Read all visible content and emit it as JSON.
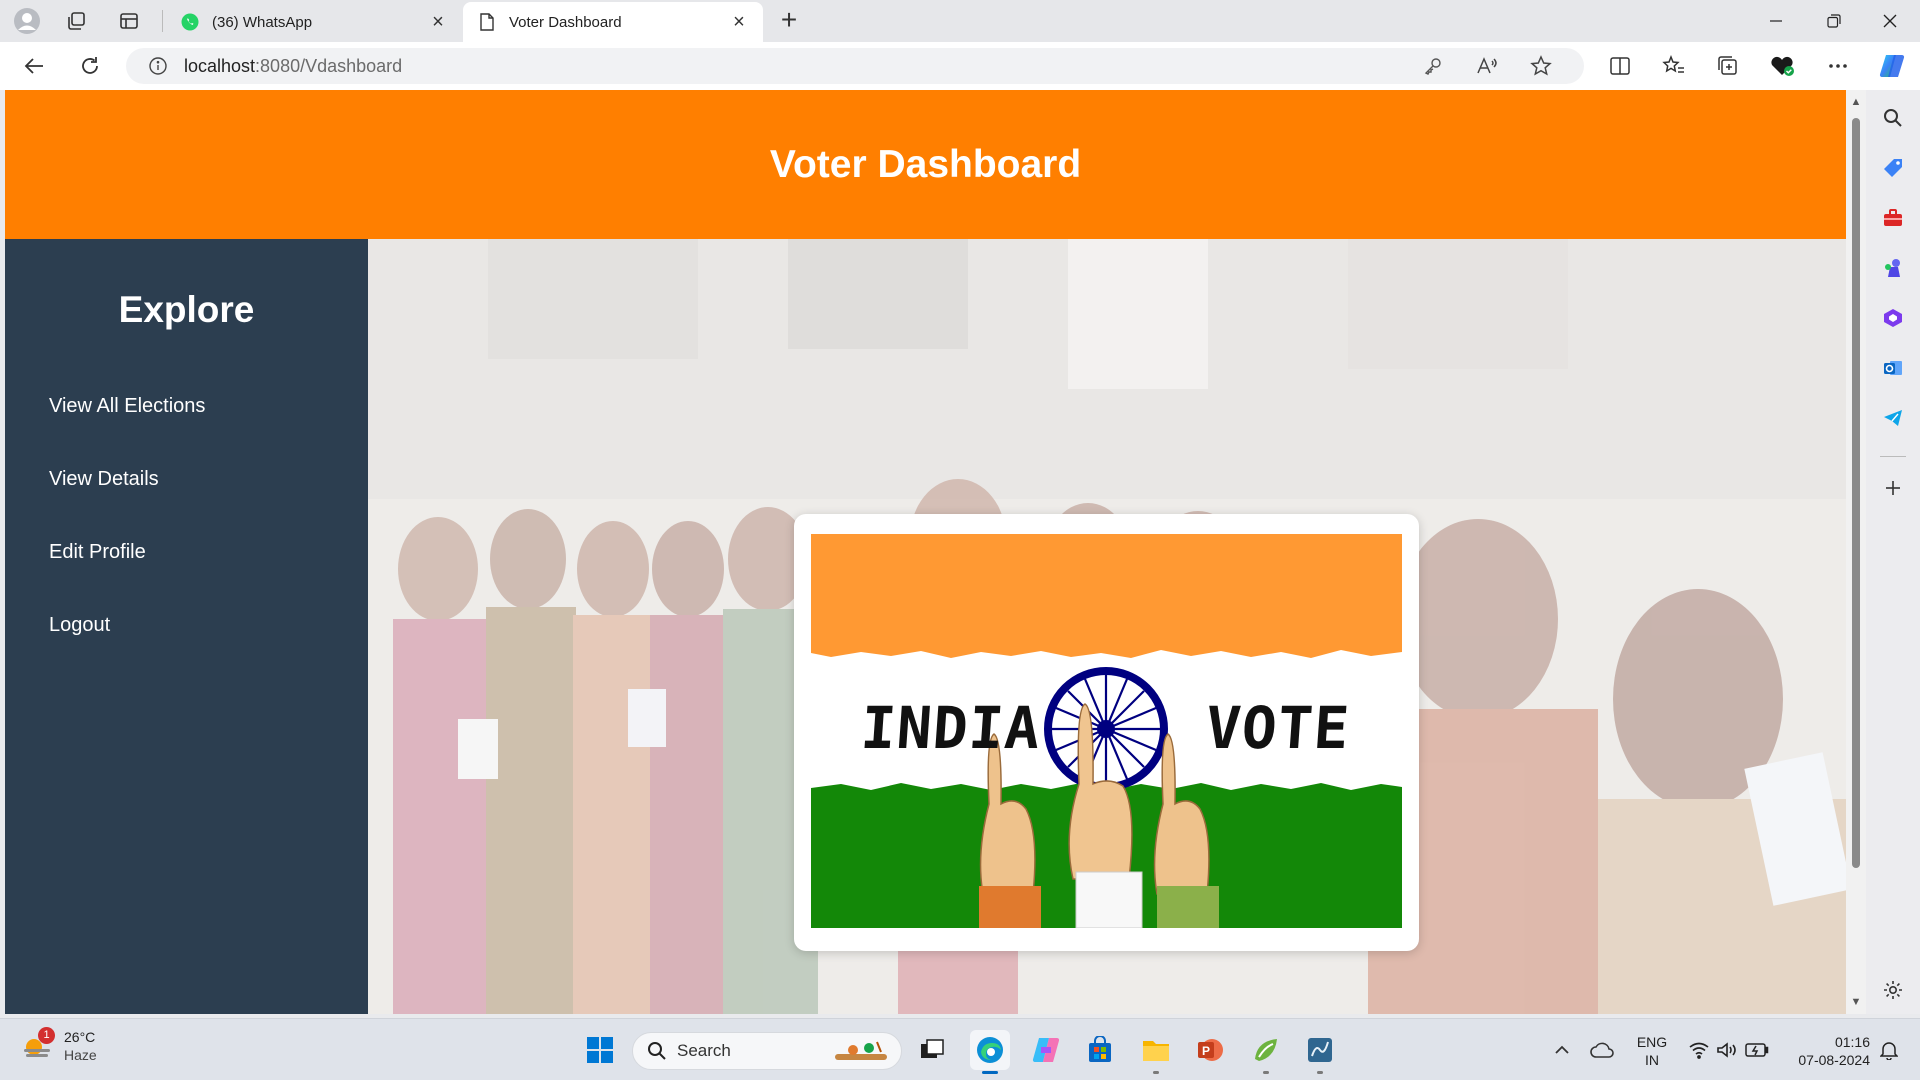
{
  "browser": {
    "tabs": [
      {
        "title": "(36) WhatsApp",
        "active": false
      },
      {
        "title": "Voter Dashboard",
        "active": true
      }
    ],
    "url_host": "localhost",
    "url_path": ":8080/Vdashboard"
  },
  "page": {
    "header_title": "Voter Dashboard",
    "sidebar": {
      "heading": "Explore",
      "links": [
        "View All Elections",
        "View Details",
        "Edit Profile",
        "Logout"
      ]
    },
    "banner": {
      "word_left": "INDIA",
      "word_right": "VOTE",
      "colors": {
        "saffron": "#ff9933",
        "white": "#ffffff",
        "green": "#138808",
        "chakra": "#000080"
      }
    }
  },
  "colors": {
    "header": "#ff7f00",
    "sidebar": "#2c3e50",
    "accent": "#0067c0"
  },
  "taskbar": {
    "weather_temp": "26°C",
    "weather_desc": "Haze",
    "weather_badge": "1",
    "search_placeholder": "Search",
    "lang_line1": "ENG",
    "lang_line2": "IN",
    "time": "01:16",
    "date": "07-08-2024"
  }
}
